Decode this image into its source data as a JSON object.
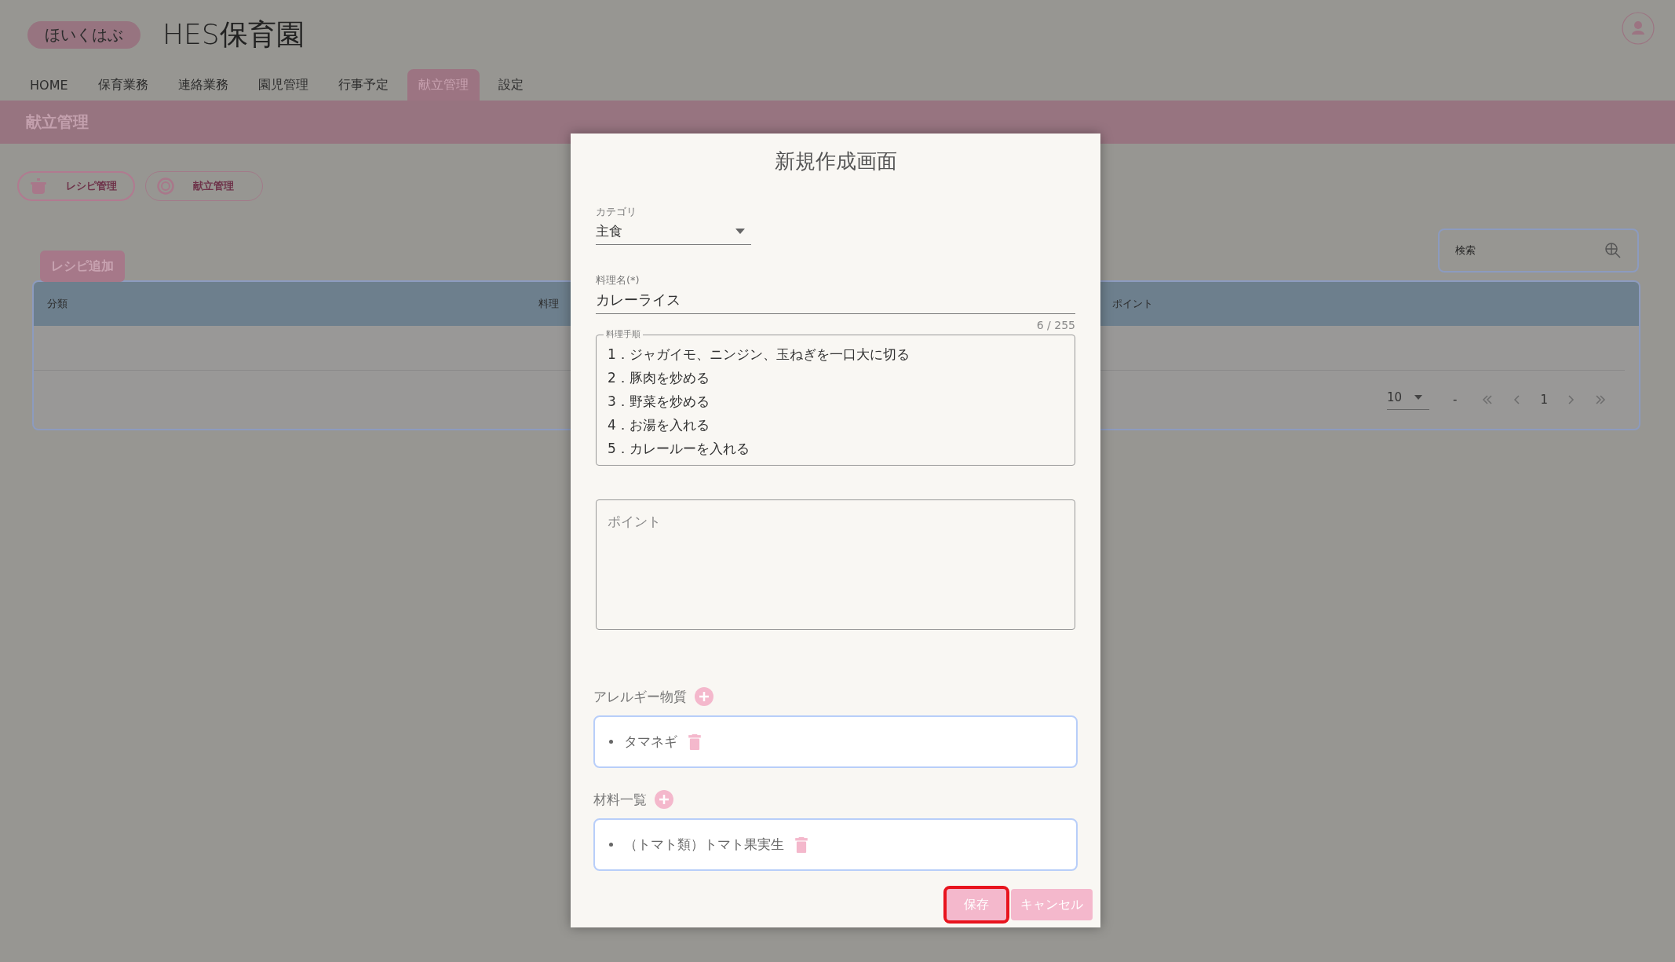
{
  "header": {
    "logo": "ほいくはぶ",
    "title": "HES保育園"
  },
  "nav": [
    {
      "label": "HOME",
      "selected": false
    },
    {
      "label": "保育業務",
      "selected": false
    },
    {
      "label": "連絡業務",
      "selected": false
    },
    {
      "label": "園児管理",
      "selected": false
    },
    {
      "label": "行事予定",
      "selected": false
    },
    {
      "label": "献立管理",
      "selected": true
    },
    {
      "label": "設定",
      "selected": false
    }
  ],
  "page_title": "献立管理",
  "mode_buttons": [
    {
      "label": "レシピ管理",
      "selected": true,
      "kind": "pot"
    },
    {
      "label": "献立管理",
      "selected": false,
      "kind": "plate"
    }
  ],
  "add_button": "レシピ追加",
  "search": {
    "placeholder": "検索"
  },
  "table": {
    "columns": [
      "分類",
      "料理",
      "ポイント"
    ]
  },
  "pagination": {
    "per_page": "10",
    "range": "-",
    "page": "1"
  },
  "dialog": {
    "title": "新規作成画面",
    "category": {
      "label": "カテゴリ",
      "value": "主食"
    },
    "name": {
      "label": "料理名(*)",
      "value": "カレーライス",
      "counter": "6 / 255"
    },
    "steps": {
      "label": "料理手順",
      "lines": [
        "1．ジャガイモ、ニンジン、玉ねぎを一口大に切る",
        "2．豚肉を炒める",
        "3．野菜を炒める",
        "4．お湯を入れる",
        "5．カレールーを入れる"
      ]
    },
    "point": {
      "placeholder": "ポイント"
    },
    "allergens": {
      "label": "アレルギー物質",
      "items": [
        "タマネギ"
      ]
    },
    "ingredients": {
      "label": "材料一覧",
      "items": [
        "（トマト類）トマト果実生"
      ]
    },
    "buttons": [
      {
        "label": "保存",
        "focused": true
      },
      {
        "label": "キャンセル",
        "focused": false
      }
    ]
  }
}
